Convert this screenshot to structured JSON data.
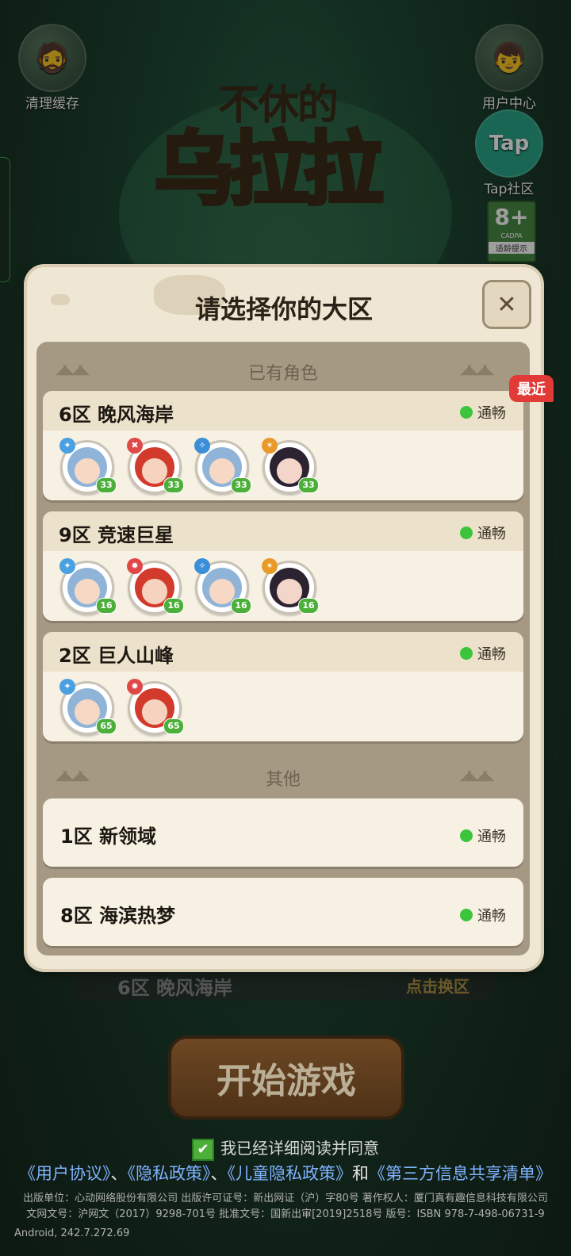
{
  "top": {
    "clear_cache": "清理缓存",
    "user_center": "用户中心",
    "tap_community": "Tap社区",
    "age_rating": "8+",
    "age_org": "CADPA",
    "age_tip": "适龄提示"
  },
  "logo": {
    "line1": "不休的",
    "line2": "乌拉拉"
  },
  "modal": {
    "title": "请选择你的大区",
    "section_existing": "已有角色",
    "section_other": "其他",
    "recent_badge": "最近",
    "servers_with_roles": [
      {
        "name": "6区  晚风海岸",
        "status": "通畅",
        "roles": [
          {
            "style": "blue",
            "cls_color": "#4aa0e0",
            "cls": "✦",
            "level": "33"
          },
          {
            "style": "red",
            "cls_color": "#e04848",
            "cls": "✖",
            "level": "33"
          },
          {
            "style": "blue",
            "cls_color": "#3a8fd8",
            "cls": "✧",
            "level": "33"
          },
          {
            "style": "dark",
            "cls_color": "#e89a2a",
            "cls": "✶",
            "level": "33"
          }
        ]
      },
      {
        "name": "9区  竞速巨星",
        "status": "通畅",
        "roles": [
          {
            "style": "blue",
            "cls_color": "#4aa0e0",
            "cls": "✦",
            "level": "16"
          },
          {
            "style": "red",
            "cls_color": "#e04848",
            "cls": "✹",
            "level": "16"
          },
          {
            "style": "blue",
            "cls_color": "#3a8fd8",
            "cls": "✧",
            "level": "16"
          },
          {
            "style": "dark",
            "cls_color": "#e89a2a",
            "cls": "✶",
            "level": "16"
          }
        ]
      },
      {
        "name": "2区  巨人山峰",
        "status": "通畅",
        "roles": [
          {
            "style": "blue",
            "cls_color": "#4aa0e0",
            "cls": "✦",
            "level": "65"
          },
          {
            "style": "red",
            "cls_color": "#e04848",
            "cls": "✹",
            "level": "65"
          }
        ]
      }
    ],
    "servers_other": [
      {
        "name": "1区  新领域",
        "status": "通畅"
      },
      {
        "name": "8区  海滨热梦",
        "status": "通畅"
      }
    ]
  },
  "bottom": {
    "current_server": "6区  晚风海岸",
    "switch_server": "点击换区",
    "start_game": "开始游戏",
    "agree_text": "我已经详细阅读并同意",
    "link_user": "《用户协议》",
    "link_privacy": "《隐私政策》",
    "link_child": "《儿童隐私政策》",
    "link_third": "《第三方信息共享清单》",
    "sep1": "、",
    "sep2": "、",
    "and": "和",
    "publisher_line": "出版单位：心动网络股份有限公司 出版许可证号：新出网证（沪）字80号 著作权人：厦门真有趣信息科技有限公司",
    "license_line": "文网文号：沪网文（2017）9298-701号 批准文号：国新出审[2019]2518号 版号：ISBN 978-7-498-06731-9",
    "version": "Android, 242.7.272.69"
  }
}
